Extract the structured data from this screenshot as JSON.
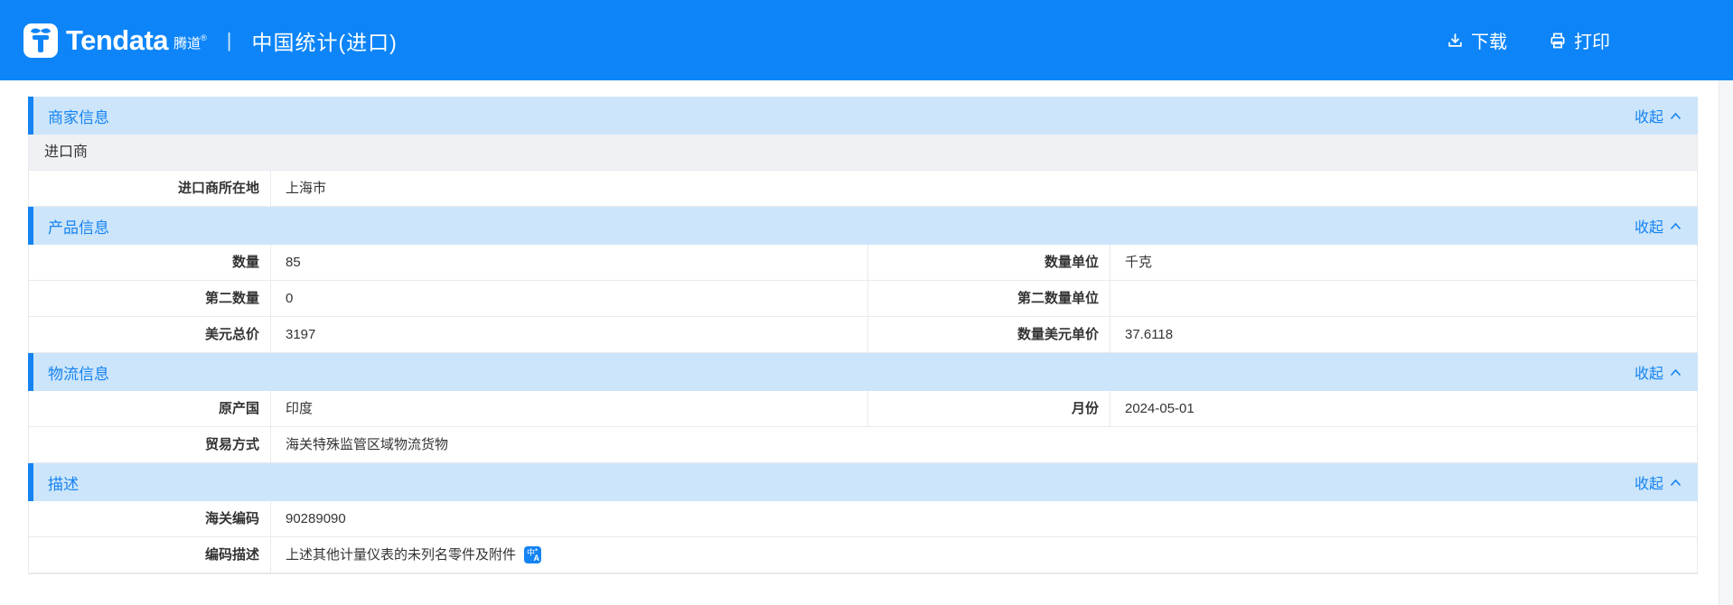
{
  "colors": {
    "header_bg": "#0d85f8",
    "accent": "#1583f2",
    "band_bg": "#cce5fa"
  },
  "header": {
    "brand": {
      "name": "Tendata",
      "cn": "腾道",
      "reg": "®"
    },
    "separator": "|",
    "title": "中国统计(进口)",
    "download_label": "下载",
    "print_label": "打印"
  },
  "ui": {
    "collapse_label": "收起"
  },
  "sections": {
    "merchant": {
      "title": "商家信息",
      "importer_label": "进口商",
      "rows": {
        "location": {
          "label": "进口商所在地",
          "value": "上海市"
        }
      }
    },
    "product": {
      "title": "产品信息",
      "rows": {
        "qty": {
          "label1": "数量",
          "value1": "85",
          "label2": "数量单位",
          "value2": "千克"
        },
        "qty2": {
          "label1": "第二数量",
          "value1": "0",
          "label2": "第二数量单位",
          "value2": ""
        },
        "usd": {
          "label1": "美元总价",
          "value1": "3197",
          "label2": "数量美元单价",
          "value2": "37.6118"
        }
      }
    },
    "logistics": {
      "title": "物流信息",
      "rows": {
        "origin": {
          "label1": "原产国",
          "value1": "印度",
          "label2": "月份",
          "value2": "2024-05-01"
        },
        "trade": {
          "label": "贸易方式",
          "value": "海关特殊监管区域物流货物"
        }
      }
    },
    "description": {
      "title": "描述",
      "rows": {
        "hs": {
          "label": "海关编码",
          "value": "90289090"
        },
        "desc": {
          "label": "编码描述",
          "value": "上述其他计量仪表的未列名零件及附件"
        }
      }
    }
  }
}
